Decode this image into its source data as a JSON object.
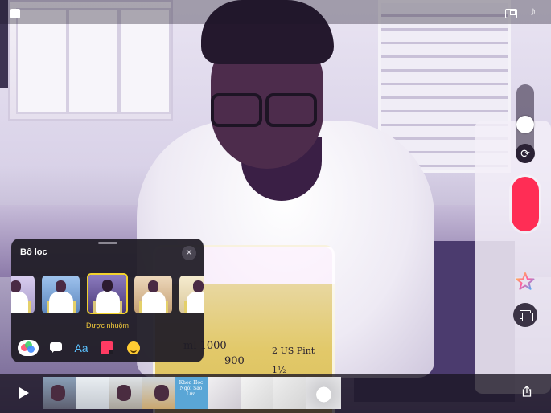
{
  "topbar": {
    "stop_icon": "stop-square-icon",
    "aspect_icon": "aspect-ratio-icon",
    "music_icon": "music-note-icon",
    "music_glyph": "♪"
  },
  "camera_controls": {
    "zoom_level": 0.4,
    "flip_icon": "camera-flip-icon",
    "flip_glyph": "⟳",
    "record_color": "#ff2d55",
    "effects_icon": "star-effects-icon",
    "library_icon": "photo-library-icon"
  },
  "filters_panel": {
    "title": "Bộ lọc",
    "close_glyph": "✕",
    "selected_filter_label": "Được nhuộm",
    "selected_index": 2,
    "accent": "#f2d22c",
    "filters": [
      {
        "tint": "#c9b7e6"
      },
      {
        "tint": "#7fa7d8"
      },
      {
        "tint": "#5b4a8a"
      },
      {
        "tint": "#d6b88f"
      },
      {
        "tint": "#e8dcb6"
      }
    ],
    "tools": {
      "filters_icon": "filters-icon",
      "speech_icon": "speech-bubble-icon",
      "text_icon": "text-style-icon",
      "text_glyph": "Aa",
      "sticker_icon": "sticker-icon",
      "emoji_icon": "emoji-icon"
    }
  },
  "scene_text": {
    "beaker_line1": "ml 1000",
    "beaker_line2": "900",
    "beaker_unit1": "2 US Pint",
    "beaker_unit2": "1½"
  },
  "timeline": {
    "play_icon": "play-icon",
    "share_icon": "share-icon",
    "title_card_text": "Khoa Học Ngôi Sao Lửa"
  }
}
